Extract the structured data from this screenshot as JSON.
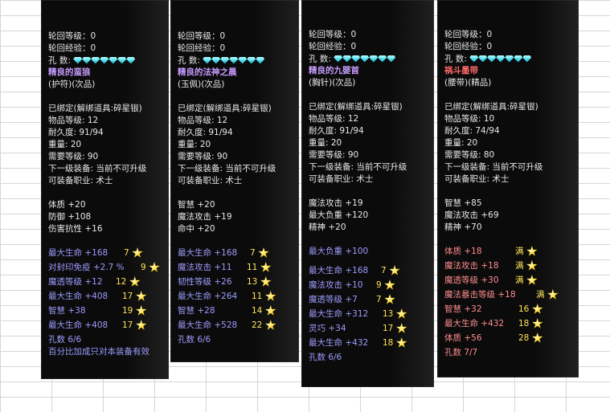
{
  "panels": [
    {
      "reincarnation_level": "轮回等级：0",
      "reincarnation_exp": "轮回经验：0",
      "holes_label": "孔    数:",
      "gem_count": 7,
      "item_name": "精良的蛮狼",
      "item_type": "(护符)(次品)",
      "bound": "已绑定(解绑道具:碎星银)",
      "item_level": "物品等级: 12",
      "durability": "耐久度: 91/94",
      "weight": "重量: 20",
      "req_level": "需要等级: 90",
      "next_equip": "下一级装备: 当前不可升级",
      "profession": "可装备职业: 术士",
      "base_stats": [
        "体质 +20",
        "防御 +108",
        "伤害抗性 +16"
      ],
      "extra_stats": [
        {
          "label": "最大生命 +168",
          "stars": "7"
        },
        {
          "label": "对封印免疫 +2.7 %",
          "stars": "9"
        },
        {
          "label": "魔透等级 +12",
          "stars": "12"
        },
        {
          "label": "最大生命 +408",
          "stars": "17"
        },
        {
          "label": "智慧      +38",
          "stars": "19"
        },
        {
          "label": "最大生命 +408",
          "stars": "17"
        }
      ],
      "holes_footer": "孔数 6/6",
      "note": "百分比加成只对本装备有效"
    },
    {
      "reincarnation_level": "轮回等级：0",
      "reincarnation_exp": "轮回经验：0",
      "holes_label": "孔    数:",
      "gem_count": 7,
      "item_name": "精良的法神之晨",
      "item_type": "(玉佩)(次品)",
      "bound": "已绑定(解绑道具:碎星银)",
      "item_level": "物品等级: 12",
      "durability": "耐久度: 91/94",
      "weight": "重量: 20",
      "req_level": "需要等级: 90",
      "next_equip": "下一级装备: 当前不可升级",
      "profession": "可装备职业: 术士",
      "base_stats": [
        "智慧 +20",
        "魔法攻击 +19",
        "命中 +20"
      ],
      "extra_stats": [
        {
          "label": "最大生命 +168",
          "stars": "7"
        },
        {
          "label": "魔法攻击 +11",
          "stars": "11"
        },
        {
          "label": "韧性等级 +26",
          "stars": "13"
        },
        {
          "label": "最大生命 +264",
          "stars": "11"
        },
        {
          "label": "智慧      +28",
          "stars": "14"
        },
        {
          "label": "最大生命 +528",
          "stars": "22"
        }
      ],
      "holes_footer": "孔数 6/6"
    },
    {
      "reincarnation_level": "轮回等级：0",
      "reincarnation_exp": "轮回经验：0",
      "holes_label": "孔    数:",
      "gem_count": 7,
      "item_name": "精良的九婴首",
      "item_type": "(胸针)(次品)",
      "bound": "已绑定(解绑道具:碎星银)",
      "item_level": "物品等级: 12",
      "durability": "耐久度: 91/94",
      "weight": "重量: 20",
      "req_level": "需要等级: 90",
      "next_equip": "下一级装备: 当前不可升级",
      "profession": "可装备职业: 术士",
      "base_stats": [
        "魔法攻击 +19",
        "最大负重 +120",
        "精神 +20"
      ],
      "extra_stats": [
        {
          "label": "最大负重 +100",
          "stars": ""
        },
        {
          "label": "最大生命 +168",
          "stars": "7"
        },
        {
          "label": "魔法攻击 +10",
          "stars": "9"
        },
        {
          "label": "魔透等级 +7",
          "stars": "7"
        },
        {
          "label": "最大生命 +312",
          "stars": "13"
        },
        {
          "label": "灵巧      +34",
          "stars": "17"
        },
        {
          "label": "最大生命 +432",
          "stars": "18"
        }
      ],
      "holes_footer": "孔数 6/6"
    },
    {
      "reincarnation_level": "轮回等级：0",
      "reincarnation_exp": "轮回经验：0",
      "holes_label": "孔    数:",
      "gem_count": 7,
      "item_name": "祸斗墨带",
      "item_type": "(腰带)(精品)",
      "bound": "已绑定(解绑道具:碎星银)",
      "item_level": "物品等级: 10",
      "durability": "耐久度: 74/94",
      "weight": "重量: 20",
      "req_level": "需要等级: 80",
      "next_equip": "下一级装备: 当前不可升级",
      "profession": "可装备职业: 术士",
      "base_stats": [
        "智慧 +85",
        "魔法攻击 +69",
        "精神 +70"
      ],
      "extra_stats": [
        {
          "label": "体质      +18",
          "stars": "满"
        },
        {
          "label": "魔法攻击 +18",
          "stars": "满"
        },
        {
          "label": "魔透等级 +30",
          "stars": "满"
        },
        {
          "label": "魔法暴击等级 +18",
          "stars": "满"
        },
        {
          "label": "智慧      +32",
          "stars": "16"
        },
        {
          "label": "最大生命 +432",
          "stars": "18"
        },
        {
          "label": "体质      +56",
          "stars": "28"
        }
      ],
      "holes_footer": "孔数 7/7"
    }
  ]
}
